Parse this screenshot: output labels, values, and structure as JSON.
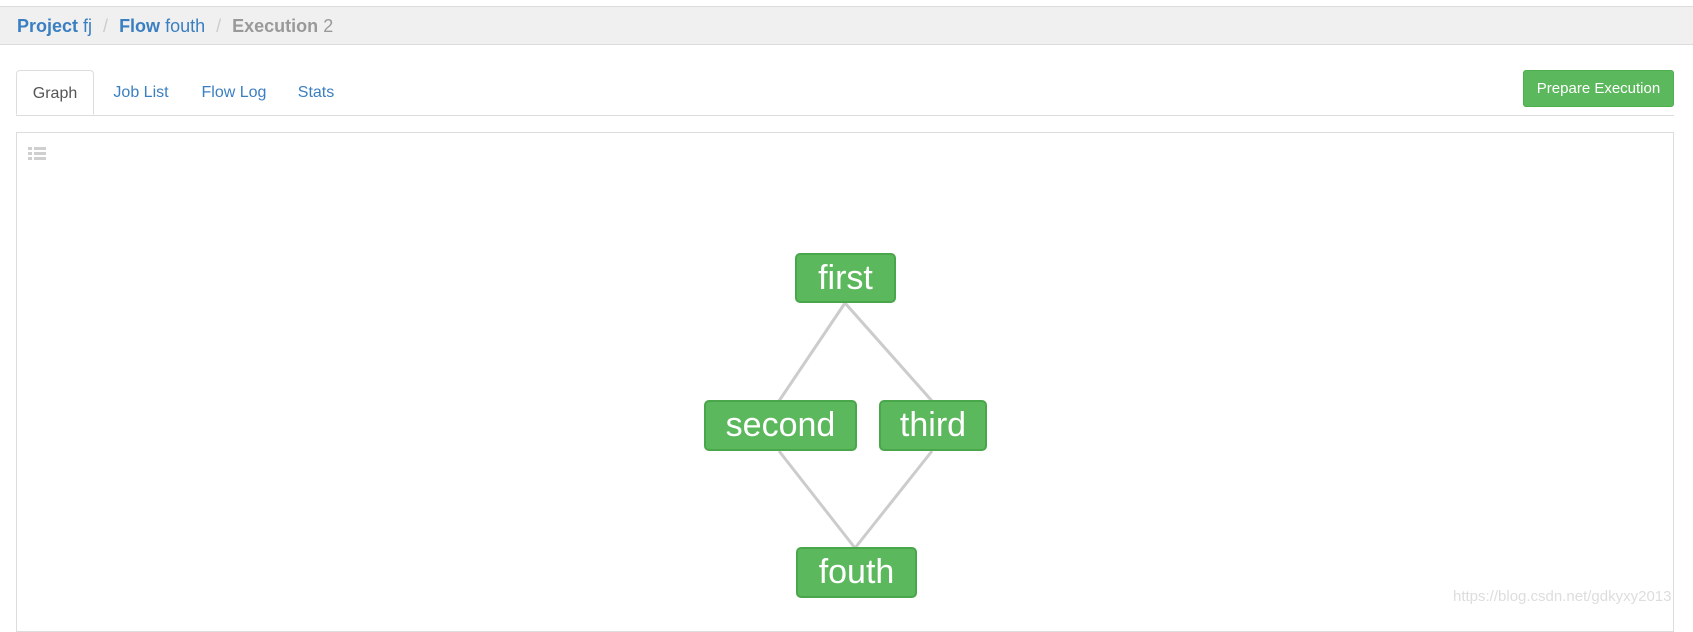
{
  "breadcrumb": {
    "project_label": "Project",
    "project_value": "fj",
    "flow_label": "Flow",
    "flow_value": "fouth",
    "execution_label": "Execution",
    "execution_value": "2",
    "separator": "/"
  },
  "tabs": [
    {
      "label": "Graph",
      "active": true
    },
    {
      "label": "Job List",
      "active": false
    },
    {
      "label": "Flow Log",
      "active": false
    },
    {
      "label": "Stats",
      "active": false
    }
  ],
  "actions": {
    "prepare_execution_label": "Prepare Execution"
  },
  "graph": {
    "list_toggle_icon": "list-icon",
    "nodes": [
      {
        "id": "first",
        "label": "first"
      },
      {
        "id": "second",
        "label": "second"
      },
      {
        "id": "third",
        "label": "third"
      },
      {
        "id": "fouth",
        "label": "fouth"
      }
    ],
    "edges": [
      {
        "from": "first",
        "to": "second"
      },
      {
        "from": "first",
        "to": "third"
      },
      {
        "from": "second",
        "to": "fouth"
      },
      {
        "from": "third",
        "to": "fouth"
      }
    ],
    "node_color": "#5cb85c",
    "edge_color": "#cccccc"
  },
  "watermark": "https://blog.csdn.net/gdkyxy2013"
}
